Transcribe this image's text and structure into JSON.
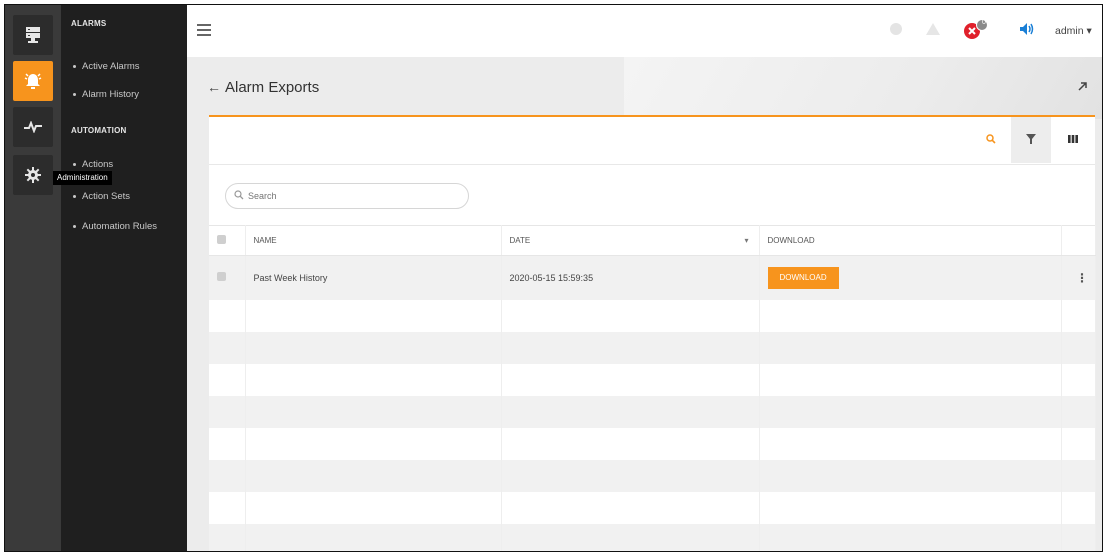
{
  "rail": {
    "items": [
      {
        "icon": "server-icon",
        "active": false
      },
      {
        "icon": "alarm-bell-icon",
        "active": true
      },
      {
        "icon": "pulse-icon",
        "active": false
      },
      {
        "icon": "gear-icon",
        "active": false
      }
    ],
    "tooltip": "Administration"
  },
  "nav": {
    "sections": [
      {
        "title": "ALARMS",
        "items": [
          "Active Alarms",
          "Alarm History"
        ]
      },
      {
        "title": "AUTOMATION",
        "items": [
          "Actions",
          "Action Sets",
          "Automation Rules"
        ]
      }
    ]
  },
  "topbar": {
    "notification_count": "0",
    "user": "admin ▾"
  },
  "page": {
    "back": "←",
    "title": "Alarm Exports"
  },
  "search": {
    "placeholder": "Search"
  },
  "table": {
    "columns": [
      "",
      "NAME",
      "DATE",
      "DOWNLOAD",
      ""
    ],
    "sort_indicator": "▾",
    "rows": [
      {
        "name": "Past Week History",
        "date": "2020-05-15 15:59:35",
        "download_label": "DOWNLOAD"
      }
    ]
  },
  "colors": {
    "accent": "#f7941d",
    "rail_bg": "#3a3a3a",
    "nav_bg": "#1f1f1f",
    "error": "#e0202b",
    "info": "#1a7fd6"
  }
}
